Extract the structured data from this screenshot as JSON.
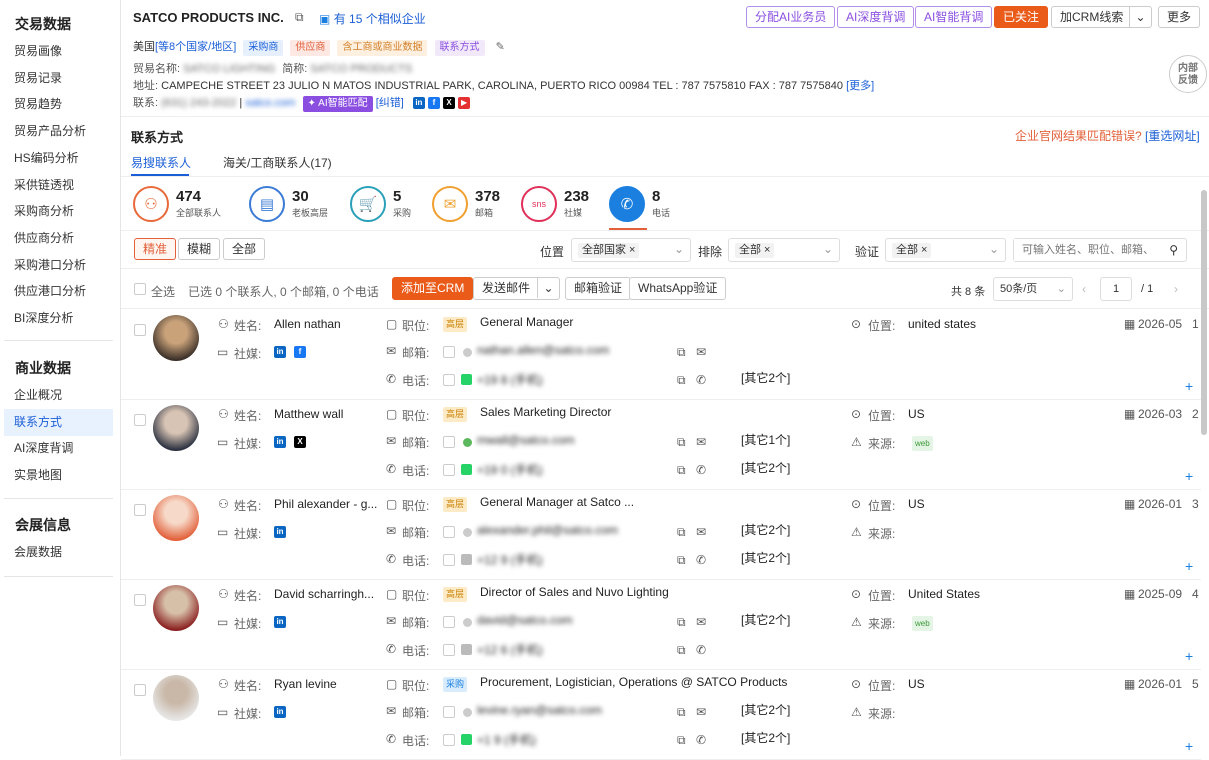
{
  "sidebar": {
    "trade_title": "交易数据",
    "trade_items": [
      "贸易画像",
      "贸易记录",
      "贸易趋势",
      "贸易产品分析",
      "HS编码分析",
      "采供链透视",
      "采购商分析",
      "供应商分析",
      "采购港口分析",
      "供应港口分析",
      "BI深度分析"
    ],
    "biz_title": "商业数据",
    "biz_items": [
      "企业概况",
      "联系方式",
      "AI深度背调",
      "实景地图"
    ],
    "expo_title": "会展信息",
    "expo_items": [
      "会展数据"
    ]
  },
  "company": {
    "name": "SATCO PRODUCTS INC.",
    "similar": "有 15 个相似企业",
    "country": "美国",
    "countries_link": "[等8个国家/地区]",
    "tags": [
      "采购商",
      "供应商",
      "含工商或商业数据",
      "联系方式"
    ],
    "trade_name_label": "贸易名称:",
    "trade_name": "SATCO LIGHTING",
    "short_name_label": "简称:",
    "short_name": "SATCO PRODUCTS",
    "address_label": "地址:",
    "address": "CAMPECHE STREET 23 JULIO N MATOS INDUSTRIAL PARK, CAROLINA, PUERTO RICO 00984 TEL : 787 7575810 FAX : 787 7575840",
    "more": "[更多]",
    "contact_label": "联系:",
    "phone": "(631) 243-2022",
    "email": "satco.com",
    "ai_match": "AI智能匹配",
    "correction": "[纠错]"
  },
  "actions": {
    "ai_assign": "分配AI业务员",
    "ai_deep": "AI深度背调",
    "ai_smart": "AI智能背调",
    "followed": "已关注",
    "add_crm": "加CRM线索",
    "more": "更多",
    "feedback": "内部反馈"
  },
  "contacts": {
    "title": "联系方式",
    "mismatch": "企业官网结果匹配错误?",
    "reselect": "[重选网址]",
    "tabs": [
      "易搜联系人",
      "海关/工商联系人(17)"
    ],
    "stats": [
      {
        "num": "474",
        "label": "全部联系人",
        "icon": "people-icon",
        "color": "#e86a3a"
      },
      {
        "num": "30",
        "label": "老板高层",
        "icon": "briefcase-icon",
        "color": "#3a7bd5"
      },
      {
        "num": "5",
        "label": "采购",
        "icon": "cart-icon",
        "color": "#2aa0b8"
      },
      {
        "num": "378",
        "label": "邮箱",
        "icon": "mail-icon",
        "color": "#f0a030"
      },
      {
        "num": "238",
        "label": "社媒",
        "icon": "sns-icon",
        "color": "#e0305a"
      },
      {
        "num": "8",
        "label": "电话",
        "icon": "phone-icon",
        "color": "#1b7fe0"
      }
    ],
    "filters": {
      "exact": "精准",
      "fuzzy": "模糊",
      "all": "全部",
      "position_label": "位置",
      "position_val": "全部国家",
      "exclude_label": "排除",
      "exclude_val": "全部",
      "verify_label": "验证",
      "verify_val": "全部",
      "search_placeholder": "可输入姓名、职位、邮箱、"
    },
    "toolbar": {
      "select_all": "全选",
      "selected": "已选 0 个联系人, 0 个邮箱, 0 个电话",
      "add_crm": "添加至CRM",
      "send_mail": "发送邮件",
      "verify_mail": "邮箱验证",
      "verify_wa": "WhatsApp验证",
      "total": "共 8 条",
      "per_page": "50条/页",
      "page": "1",
      "pages": "/ 1"
    },
    "labels": {
      "name": "姓名:",
      "social": "社媒:",
      "position": "职位:",
      "email": "邮箱:",
      "phone": "电话:",
      "location": "位置:",
      "source": "来源:"
    },
    "rows": [
      {
        "name": "Allen nathan",
        "level": "高层",
        "title": "General Manager",
        "email": "nathan.allen@satco.com",
        "phone": "+19 8 (手机)",
        "others_email": "",
        "others_phone": "[其它2个]",
        "location": "united states",
        "source": "",
        "date": "2026-05",
        "n": "1",
        "socials": [
          "in",
          "f"
        ]
      },
      {
        "name": "Matthew wall",
        "level": "高层",
        "title": "Sales Marketing Director",
        "email": "mwall@satco.com",
        "phone": "+19 0 (手机)",
        "others_email": "[其它1个]",
        "others_phone": "[其它2个]",
        "location": "US",
        "source": "web",
        "date": "2026-03",
        "n": "2",
        "socials": [
          "in",
          "x"
        ]
      },
      {
        "name": "Phil alexander - g...",
        "level": "高层",
        "title": "General Manager at Satco ...",
        "email": "alexander.phil@satco.com",
        "phone": "+12 9 (手机)",
        "others_email": "[其它2个]",
        "others_phone": "[其它2个]",
        "location": "US",
        "source": "",
        "date": "2026-01",
        "n": "3",
        "socials": [
          "in"
        ]
      },
      {
        "name": "David scharringh...",
        "level": "高层",
        "title": "Director of Sales and Nuvo Lighting",
        "email": "david@satco.com",
        "phone": "+12 6 (手机)",
        "others_email": "[其它2个]",
        "others_phone": "",
        "location": "United States",
        "source": "web",
        "date": "2025-09",
        "n": "4",
        "socials": [
          "in"
        ]
      },
      {
        "name": "Ryan levine",
        "level": "采购",
        "title": "Procurement, Logistician, Operations @ SATCO Products",
        "email": "levine.ryan@satco.com",
        "phone": "+1 9 (手机)",
        "others_email": "[其它2个]",
        "others_phone": "[其它2个]",
        "location": "US",
        "source": "",
        "date": "2026-01",
        "n": "5",
        "socials": [
          "in"
        ]
      }
    ]
  }
}
